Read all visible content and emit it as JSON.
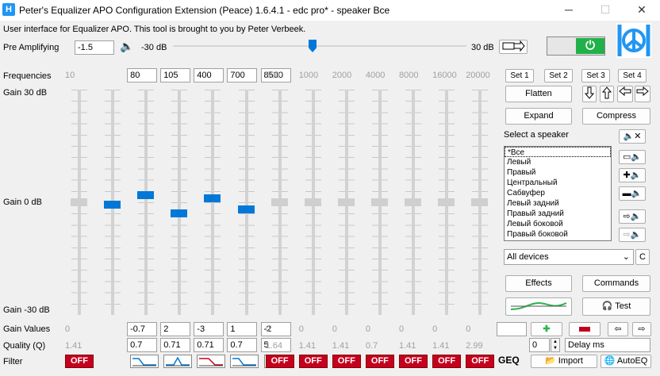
{
  "window": {
    "title": "Peter's Equalizer APO Configuration Extension (Peace) 1.6.4.1 - edc pro* - speaker Все",
    "logo": "H",
    "min": "─",
    "max": "☐",
    "close": "✕"
  },
  "intro": "User interface for Equalizer APO. This tool is brought to you by Peter Verbeek.",
  "preamp": {
    "label": "Pre Amplifying",
    "value": "-1.5",
    "min_label": "-30 dB",
    "max_label": "30 dB",
    "level_fraction": 0.475,
    "speaker_icon": "🔈"
  },
  "eq": {
    "freq_label": "Frequencies",
    "gain_top": "Gain 30 dB",
    "gain_mid": "Gain 0 dB",
    "gain_bot": "Gain -30 dB",
    "gain_values_label": "Gain Values",
    "quality_label": "Quality (Q)",
    "filter_label": "Filter",
    "bands": [
      {
        "freq": "10",
        "active": false,
        "gain": "0",
        "gain_num": 0,
        "q": "1.41",
        "filter": "OFF"
      },
      {
        "freq": "80",
        "active": true,
        "gain": "-0.7",
        "gain_num": -0.7,
        "q": "0.7",
        "filter": "low-shelf"
      },
      {
        "freq": "105",
        "active": true,
        "gain": "2",
        "gain_num": 2,
        "q": "0.71",
        "filter": "peak"
      },
      {
        "freq": "400",
        "active": true,
        "gain": "-3",
        "gain_num": -3,
        "q": "0.71",
        "filter": "low-pass"
      },
      {
        "freq": "700",
        "active": true,
        "gain": "1",
        "gain_num": 1,
        "q": "0.7",
        "filter": "low-shelf"
      },
      {
        "freq": "8500",
        "active": true,
        "gain": "-2",
        "gain_num": -2,
        "q": "5",
        "filter": "peak"
      },
      {
        "freq": "500",
        "active": false,
        "gain": "0",
        "gain_num": 0,
        "q": "1.64",
        "filter": "OFF"
      },
      {
        "freq": "1000",
        "active": false,
        "gain": "0",
        "gain_num": 0,
        "q": "1.41",
        "filter": "OFF"
      },
      {
        "freq": "2000",
        "active": false,
        "gain": "0",
        "gain_num": 0,
        "q": "1.41",
        "filter": "OFF"
      },
      {
        "freq": "4000",
        "active": false,
        "gain": "0",
        "gain_num": 0,
        "q": "0.7",
        "filter": "OFF"
      },
      {
        "freq": "8000",
        "active": false,
        "gain": "0",
        "gain_num": 0,
        "q": "1.41",
        "filter": "OFF"
      },
      {
        "freq": "16000",
        "active": false,
        "gain": "0",
        "gain_num": 0,
        "q": "1.41",
        "filter": "OFF"
      },
      {
        "freq": "20000",
        "active": false,
        "gain": "0",
        "gain_num": 0,
        "q": "2.99",
        "filter": "OFF"
      }
    ]
  },
  "sets": [
    "Set 1",
    "Set 2",
    "Set 3",
    "Set 4"
  ],
  "buttons": {
    "flatten": "Flatten",
    "expand": "Expand",
    "compress": "Compress",
    "effects": "Effects",
    "commands": "Commands",
    "test": "Test",
    "import": "Import",
    "autoeq": "AutoEQ",
    "geq": "GEQ",
    "c": "C"
  },
  "speaker_label": "Select a speaker",
  "speakers": [
    "*Все",
    "Левый",
    "Правый",
    "Центральный",
    "Сабвуфер",
    "Левый задний",
    "Правый задний",
    "Левый боковой",
    "Правый боковой"
  ],
  "device": "All devices",
  "delay": {
    "value": "0",
    "label": "Delay ms"
  },
  "colors": {
    "accent": "#0078d7",
    "off": "#c4001f",
    "power": "#21b14b",
    "logo": "#2196f3"
  }
}
